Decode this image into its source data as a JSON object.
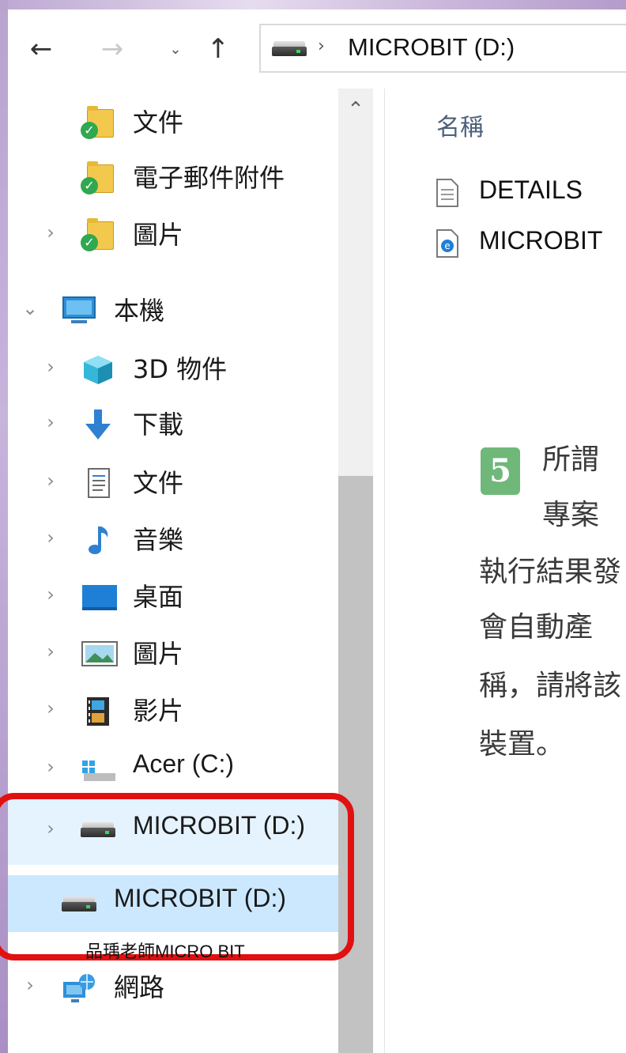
{
  "address_bar": {
    "path_label": "MICROBIT (D:)"
  },
  "nav_pane": {
    "items": [
      {
        "label": "文件",
        "icon": "documents-folder-synced-icon"
      },
      {
        "label": "電子郵件附件",
        "icon": "email-attachments-folder-synced-icon"
      },
      {
        "label": "圖片",
        "icon": "pictures-folder-synced-icon"
      },
      {
        "label": "本機",
        "icon": "this-pc-icon"
      },
      {
        "label": "3D 物件",
        "icon": "3d-objects-icon"
      },
      {
        "label": "下載",
        "icon": "downloads-icon"
      },
      {
        "label": "文件",
        "icon": "documents-icon"
      },
      {
        "label": "音樂",
        "icon": "music-icon"
      },
      {
        "label": "桌面",
        "icon": "desktop-icon"
      },
      {
        "label": "圖片",
        "icon": "pictures-icon"
      },
      {
        "label": "影片",
        "icon": "videos-icon"
      },
      {
        "label": "Acer (C:)",
        "icon": "drive-c-icon"
      },
      {
        "label": "MICROBIT (D:)",
        "icon": "drive-icon"
      },
      {
        "label": "MICROBIT (D:)",
        "icon": "drive-icon"
      },
      {
        "label": "網路",
        "icon": "network-icon"
      }
    ]
  },
  "content": {
    "column_header": "名稱",
    "files": [
      {
        "name": "DETAILS",
        "icon": "text-file-icon"
      },
      {
        "name": "MICROBIT",
        "icon": "html-file-icon"
      }
    ]
  },
  "book_overlay": {
    "badge": "5",
    "lines": [
      "所謂",
      "專案",
      "執行結果發",
      "會自動產",
      "稱，請將該",
      "裝置。"
    ]
  },
  "watermark": "品瑀老師MICRO BIT",
  "colors": {
    "highlight_red": "#e11111",
    "selection_blue": "#cce8ff",
    "hover_blue": "#e5f3ff"
  }
}
